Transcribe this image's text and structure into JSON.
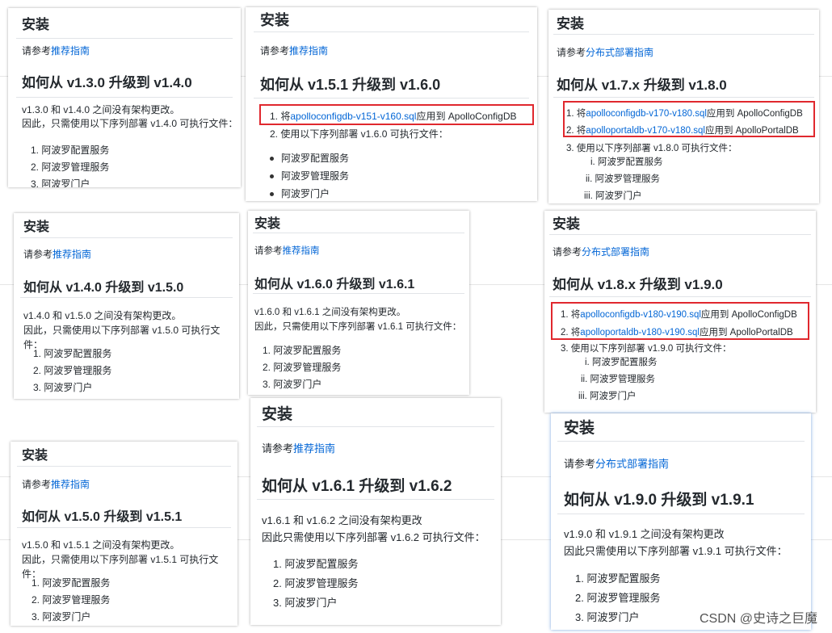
{
  "watermark": "CSDN @史诗之巨魔",
  "cards": [
    {
      "title": "安装",
      "ref_prefix": "请参考",
      "ref_link": "推荐指南",
      "heading": "如何从 v1.3.0 升级到 v1.4.0",
      "desc1": "v1.3.0 和 v1.4.0 之间没有架构更改。",
      "desc2": "因此，只需使用以下序列部署 v1.4.0 可执行文件：",
      "items": [
        "1. 阿波罗配置服务",
        "2. 阿波罗管理服务",
        "3. 阿波罗门户"
      ]
    },
    {
      "title": "安装",
      "ref_prefix": "请参考",
      "ref_link": "推荐指南",
      "heading": "如何从 v1.5.1 升级到 v1.6.0",
      "step1_prefix": "1. 将",
      "step1_link": "apolloconfigdb-v151-v160.sql",
      "step1_suffix": "应用到 ApolloConfigDB",
      "step2": "2. 使用以下序列部署 v1.6.0 可执行文件：",
      "items": [
        "阿波罗配置服务",
        "阿波罗管理服务",
        "阿波罗门户"
      ]
    },
    {
      "title": "安装",
      "ref_prefix": "请参考",
      "ref_link": "分布式部署指南",
      "heading": "如何从 v1.7.x 升级到 v1.8.0",
      "step1_prefix": "1. 将",
      "step1_link": "apolloconfigdb-v170-v180.sql",
      "step1_suffix": "应用到 ApolloConfigDB",
      "step2_prefix": "2. 将",
      "step2_link": "apolloportaldb-v170-v180.sql",
      "step2_suffix": "应用到 ApolloPortalDB",
      "step3": "3. 使用以下序列部署 v1.8.0 可执行文件：",
      "items": [
        "i. 阿波罗配置服务",
        "ii. 阿波罗管理服务",
        "iii. 阿波罗门户"
      ]
    },
    {
      "title": "安装",
      "ref_prefix": "请参考",
      "ref_link": "推荐指南",
      "heading": "如何从 v1.4.0 升级到 v1.5.0",
      "desc1": "v1.4.0 和 v1.5.0 之间没有架构更改。",
      "desc2": "因此，只需使用以下序列部署 v1.5.0 可执行文件：",
      "items": [
        "1. 阿波罗配置服务",
        "2. 阿波罗管理服务",
        "3. 阿波罗门户"
      ]
    },
    {
      "title": "安装",
      "ref_prefix": "请参考",
      "ref_link": "推荐指南",
      "heading": "如何从 v1.6.0 升级到 v1.6.1",
      "desc1": "v1.6.0 和 v1.6.1 之间没有架构更改。",
      "desc2": "因此，只需使用以下序列部署 v1.6.1 可执行文件：",
      "items": [
        "1. 阿波罗配置服务",
        "2. 阿波罗管理服务",
        "3. 阿波罗门户"
      ]
    },
    {
      "title": "安装",
      "ref_prefix": "请参考",
      "ref_link": "分布式部署指南",
      "heading": "如何从 v1.8.x 升级到 v1.9.0",
      "step1_prefix": "1. 将",
      "step1_link": "apolloconfigdb-v180-v190.sql",
      "step1_suffix": "应用到 ApolloConfigDB",
      "step2_prefix": "2. 将",
      "step2_link": "apolloportaldb-v180-v190.sql",
      "step2_suffix": "应用到 ApolloPortalDB",
      "step3": "3. 使用以下序列部署 v1.9.0 可执行文件：",
      "items": [
        "i. 阿波罗配置服务",
        "ii. 阿波罗管理服务",
        "iii. 阿波罗门户"
      ]
    },
    {
      "title": "安装",
      "ref_prefix": "请参考",
      "ref_link": "推荐指南",
      "heading": "如何从 v1.5.0 升级到 v1.5.1",
      "desc1": "v1.5.0 和 v1.5.1 之间没有架构更改。",
      "desc2": "因此，只需使用以下序列部署 v1.5.1 可执行文件：",
      "items": [
        "1. 阿波罗配置服务",
        "2. 阿波罗管理服务",
        "3. 阿波罗门户"
      ]
    },
    {
      "title": "安装",
      "ref_prefix": "请参考",
      "ref_link": "推荐指南",
      "heading": "如何从 v1.6.1 升级到 v1.6.2",
      "desc1": "v1.6.1 和 v1.6.2 之间没有架构更改",
      "desc2": "因此只需使用以下序列部署 v1.6.2 可执行文件：",
      "items": [
        "1. 阿波罗配置服务",
        "2. 阿波罗管理服务",
        "3. 阿波罗门户"
      ]
    },
    {
      "title": "安装",
      "ref_prefix": "请参考",
      "ref_link": "分布式部署指南",
      "heading": "如何从 v1.9.0 升级到 v1.9.1",
      "desc1": "v1.9.0 和 v1.9.1 之间没有架构更改",
      "desc2": "因此只需使用以下序列部署 v1.9.1 可执行文件：",
      "items": [
        "1. 阿波罗配置服务",
        "2. 阿波罗管理服务",
        "3. 阿波罗门户"
      ]
    }
  ]
}
